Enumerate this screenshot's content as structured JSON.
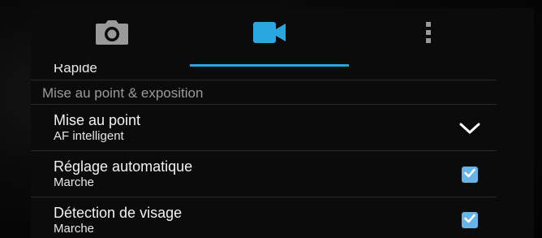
{
  "tabs": [
    {
      "icon": "camera-icon",
      "selected": false
    },
    {
      "icon": "video-camera-icon",
      "selected": true
    },
    {
      "icon": "more-vert-icon",
      "selected": false
    }
  ],
  "accent_color": "#2aa7e0",
  "checkbox_color": "#67b5e8",
  "partial_item": {
    "title": "Rapide"
  },
  "section": {
    "title": "Mise au point & exposition"
  },
  "settings": [
    {
      "title": "Mise au point",
      "value": "AF intelligent",
      "control": "dropdown",
      "control_icon": "chevron-down-icon"
    },
    {
      "title": "Réglage automatique",
      "value": "Marche",
      "control": "checkbox",
      "checked": true
    },
    {
      "title": "Détection de visage",
      "value": "Marche",
      "control": "checkbox",
      "checked": true
    }
  ]
}
